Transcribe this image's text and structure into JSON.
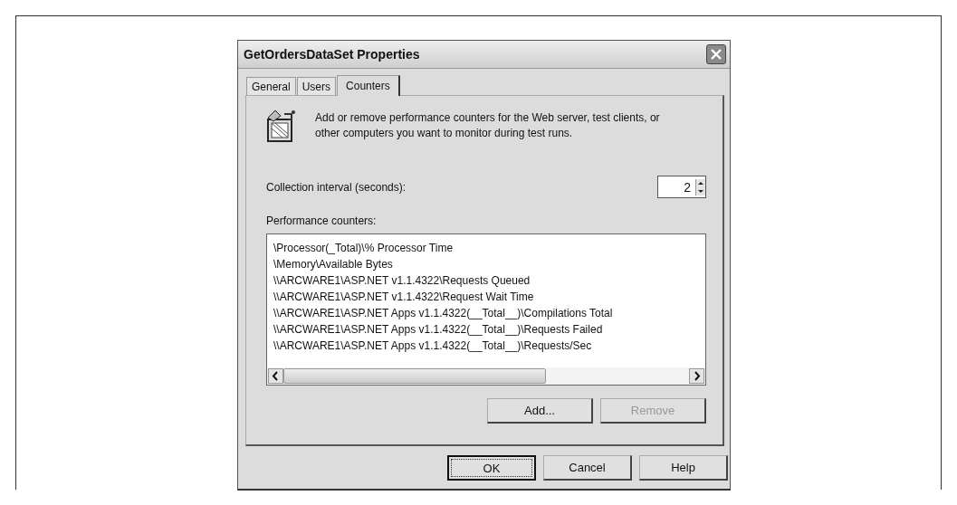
{
  "window": {
    "title": "GetOrdersDataSet Properties"
  },
  "tabs": [
    {
      "label": "General",
      "selected": false
    },
    {
      "label": "Users",
      "selected": false
    },
    {
      "label": "Counters",
      "selected": true
    }
  ],
  "description": "Add or remove performance counters for the Web server, test clients, or other computers you want to monitor during test runs.",
  "collection_interval": {
    "label": "Collection interval (seconds):",
    "value": "2"
  },
  "performance_counters": {
    "label": "Performance counters:",
    "items": [
      "\\Processor(_Total)\\% Processor Time",
      "\\Memory\\Available Bytes",
      "\\\\ARCWARE1\\ASP.NET v1.1.4322\\Requests Queued",
      "\\\\ARCWARE1\\ASP.NET v1.1.4322\\Request Wait Time",
      "\\\\ARCWARE1\\ASP.NET Apps v1.1.4322(__Total__)\\Compilations Total",
      "\\\\ARCWARE1\\ASP.NET Apps v1.1.4322(__Total__)\\Requests Failed",
      "\\\\ARCWARE1\\ASP.NET Apps v1.1.4322(__Total__)\\Requests/Sec"
    ]
  },
  "list_buttons": [
    {
      "label": "Add...",
      "disabled": false
    },
    {
      "label": "Remove",
      "disabled": true
    }
  ],
  "dialog_buttons": [
    {
      "label": "OK",
      "default": true
    },
    {
      "label": "Cancel",
      "default": false
    },
    {
      "label": "Help",
      "default": false
    }
  ]
}
